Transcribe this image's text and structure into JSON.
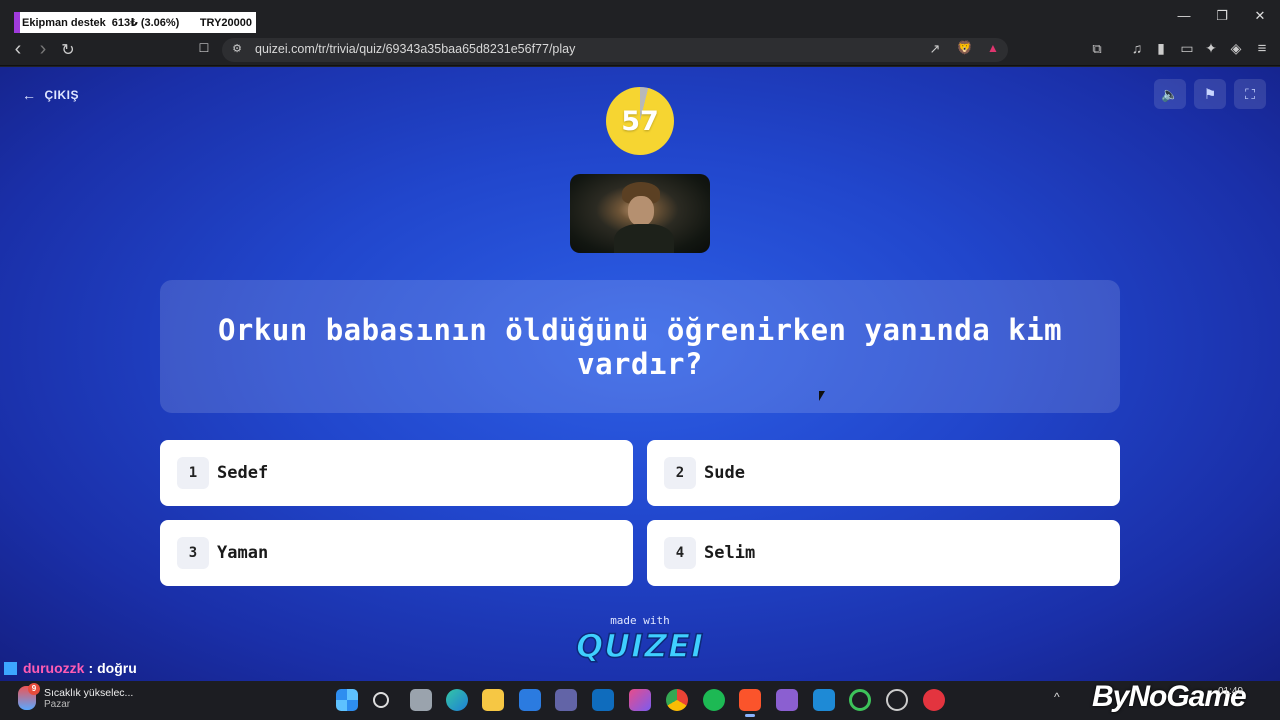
{
  "donation": {
    "name": "Ekipman destek",
    "amount": "613₺ (3.06%)",
    "target": "TRY20000"
  },
  "window": {
    "minimize_icon": "—",
    "maximize_icon": "❐",
    "close_icon": "✕"
  },
  "browser": {
    "url": "quizei.com/tr/trivia/quiz/69343a35baa65d8231e56f77/play",
    "icons": {
      "back": "‹",
      "forward": "›",
      "reload": "↻",
      "bookmark": "☐",
      "site_info": "⚙",
      "share": "↗",
      "shield": "🦁",
      "rewards": "▲",
      "screenshot": "⧉",
      "music": "♫",
      "sidebar": "▮",
      "wallet": "▭",
      "leo": "✦",
      "vpn": "◈",
      "menu": "≡"
    }
  },
  "quiz": {
    "exit_label": "ÇIKIŞ",
    "exit_icon": "←",
    "sound_icon": "🔈",
    "flag_icon": "⚑",
    "fullscreen_icon": "⛶",
    "timer": "57",
    "timer_remaining_fraction": 0.96,
    "question": "Orkun babasının öldüğünü öğrenirken yanında kim vardır?",
    "answers": [
      {
        "number": "1",
        "text": "Sedef"
      },
      {
        "number": "2",
        "text": "Sude"
      },
      {
        "number": "3",
        "text": "Yaman"
      },
      {
        "number": "4",
        "text": "Selim"
      }
    ],
    "made_with": "made with",
    "brand": "QUIZEI"
  },
  "chat": {
    "user": "duruozzk",
    "separator": ":",
    "message": "doğru"
  },
  "taskbar": {
    "weather_title": "Sıcaklık yükselec...",
    "weather_subtitle": "Pazar",
    "weather_badge": "9",
    "tray_arrow": "^",
    "clock": "01:49"
  },
  "watermark": "ByNoGame",
  "colors": {
    "background": "#2146cc",
    "timer": "#f6d531",
    "card": "#ffffff",
    "chat_user": "#ff5cb3",
    "brand": "#3fd0ff"
  }
}
